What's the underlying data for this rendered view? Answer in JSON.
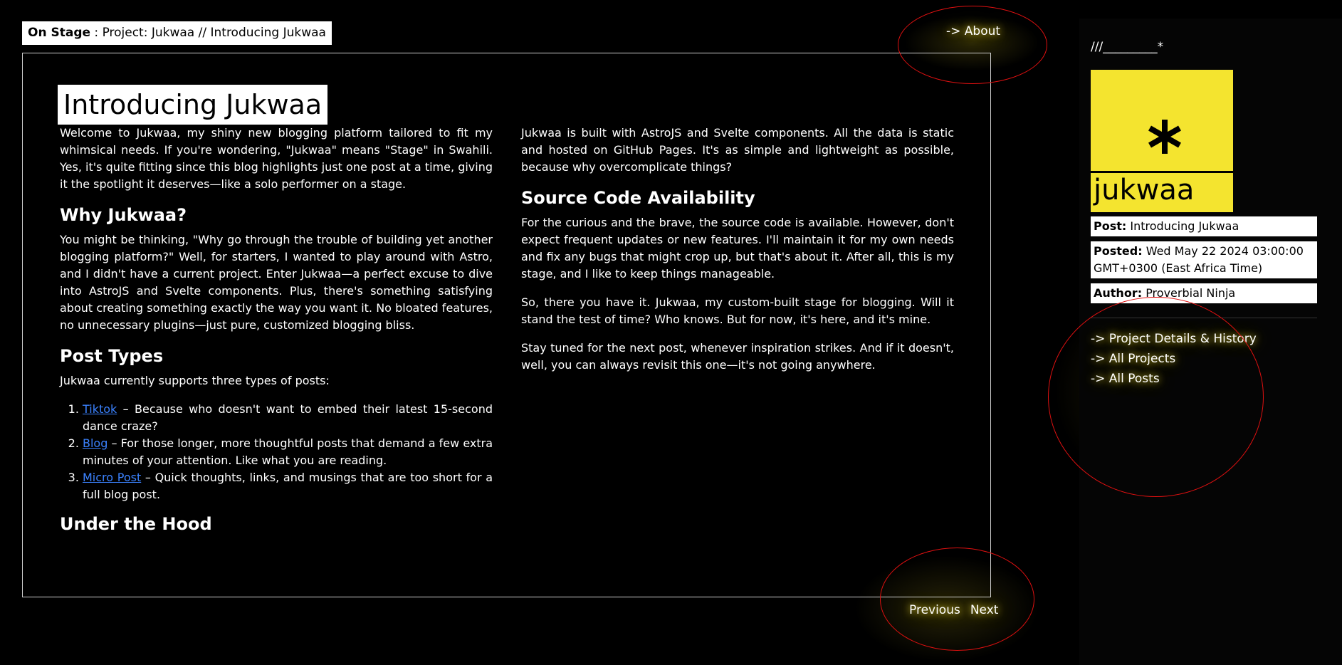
{
  "breadcrumb": {
    "prefix": "On Stage",
    "separator": " : ",
    "path": "Project: Jukwaa // Introducing Jukwaa"
  },
  "nav": {
    "about": "-> About"
  },
  "article": {
    "title": "Introducing Jukwaa",
    "left": {
      "intro": "Welcome to Jukwaa, my shiny new blogging platform tailored to fit my whimsical needs. If you're wondering, \"Jukwaa\" means \"Stage\" in Swahili. Yes, it's quite fitting since this blog highlights just one post at a time, giving it the spotlight it deserves—like a solo performer on a stage.",
      "why_heading": "Why Jukwaa?",
      "why_text": "You might be thinking, \"Why go through the trouble of building yet another blogging platform?\" Well, for starters, I wanted to play around with Astro, and I didn't have a current project. Enter Jukwaa—a perfect excuse to dive into AstroJS and Svelte components. Plus, there's something satisfying about creating something exactly the way you want it. No bloated features, no unnecessary plugins—just pure, customized blogging bliss.",
      "types_heading": "Post Types",
      "types_intro": "Jukwaa currently supports three types of posts:",
      "types": [
        {
          "link": "Tiktok",
          "text": " – Because who doesn't want to embed their latest 15-second dance craze?"
        },
        {
          "link": "Blog",
          "text": " – For those longer, more thoughtful posts that demand a few extra minutes of your attention. Like what you are reading."
        },
        {
          "link": "Micro Post",
          "text": " – Quick thoughts, links, and musings that are too short for a full blog post."
        }
      ],
      "hood_heading": "Under the Hood"
    },
    "right": {
      "hood_text": "Jukwaa is built with AstroJS and Svelte components. All the data is static and hosted on GitHub Pages. It's as simple and lightweight as possible, because why overcomplicate things?",
      "source_heading": "Source Code Availability",
      "source_text": "For the curious and the brave, the source code is available. However, don't expect frequent updates or new features. I'll maintain it for my own needs and fix any bugs that might crop up, but that's about it. After all, this is my stage, and I like to keep things manageable.",
      "closing_1": "So, there you have it. Jukwaa, my custom-built stage for blogging. Will it stand the test of time? Who knows. But for now, it's here, and it's mine.",
      "closing_2": "Stay tuned for the next post, whenever inspiration strikes. And if it doesn't, well, you can always revisit this one—it's not going anywhere."
    }
  },
  "sidebar": {
    "mark": "///_________*",
    "logo_word": "jukwaa",
    "post_label": "Post:",
    "post_value": "Introducing Jukwaa",
    "posted_label": "Posted:",
    "posted_value": "Wed May 22 2024 03:00:00 GMT+0300 (East Africa Time)",
    "author_label": "Author:",
    "author_value": "Proverbial Ninja",
    "links": [
      "-> Project Details & History",
      "-> All Projects",
      "-> All Posts"
    ]
  },
  "pager": {
    "previous": "Previous",
    "next": "Next"
  },
  "colors": {
    "background": "#000000",
    "accent_yellow": "#f4e42f",
    "link_blue": "#3b82ff",
    "annotation_red": "#e01010"
  }
}
